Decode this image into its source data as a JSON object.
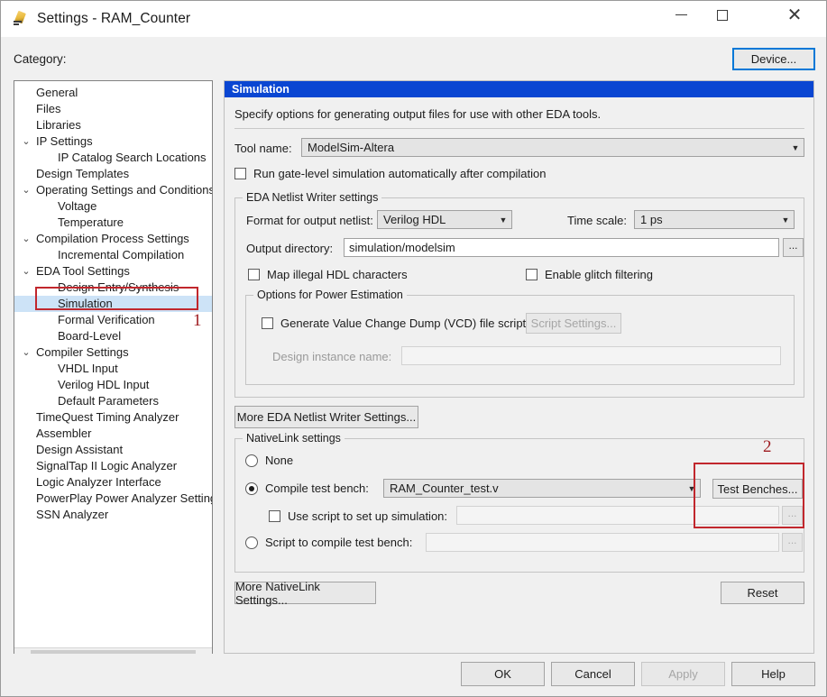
{
  "window": {
    "title": "Settings - RAM_Counter",
    "icon": "quartus-settings-icon",
    "minimize": "—",
    "maximize": "❑",
    "close": "✕"
  },
  "category": {
    "label": "Category:",
    "device_button": "Device...",
    "items": [
      {
        "label": "General",
        "level": 0,
        "chevron": "",
        "selected": false
      },
      {
        "label": "Files",
        "level": 0,
        "chevron": "",
        "selected": false
      },
      {
        "label": "Libraries",
        "level": 0,
        "chevron": "",
        "selected": false
      },
      {
        "label": "IP Settings",
        "level": 0,
        "chevron": "⌄",
        "selected": false
      },
      {
        "label": "IP Catalog Search Locations",
        "level": 1,
        "chevron": "",
        "selected": false
      },
      {
        "label": "Design Templates",
        "level": 0,
        "chevron": "",
        "selected": false
      },
      {
        "label": "Operating Settings and Conditions",
        "level": 0,
        "chevron": "⌄",
        "selected": false
      },
      {
        "label": "Voltage",
        "level": 1,
        "chevron": "",
        "selected": false
      },
      {
        "label": "Temperature",
        "level": 1,
        "chevron": "",
        "selected": false
      },
      {
        "label": "Compilation Process Settings",
        "level": 0,
        "chevron": "⌄",
        "selected": false
      },
      {
        "label": "Incremental Compilation",
        "level": 1,
        "chevron": "",
        "selected": false
      },
      {
        "label": "EDA Tool Settings",
        "level": 0,
        "chevron": "⌄",
        "selected": false
      },
      {
        "label": "Design Entry/Synthesis",
        "level": 1,
        "chevron": "",
        "selected": false
      },
      {
        "label": "Simulation",
        "level": 1,
        "chevron": "",
        "selected": true
      },
      {
        "label": "Formal Verification",
        "level": 1,
        "chevron": "",
        "selected": false
      },
      {
        "label": "Board-Level",
        "level": 1,
        "chevron": "",
        "selected": false
      },
      {
        "label": "Compiler Settings",
        "level": 0,
        "chevron": "⌄",
        "selected": false
      },
      {
        "label": "VHDL Input",
        "level": 1,
        "chevron": "",
        "selected": false
      },
      {
        "label": "Verilog HDL Input",
        "level": 1,
        "chevron": "",
        "selected": false
      },
      {
        "label": "Default Parameters",
        "level": 1,
        "chevron": "",
        "selected": false
      },
      {
        "label": "TimeQuest Timing Analyzer",
        "level": 0,
        "chevron": "",
        "selected": false
      },
      {
        "label": "Assembler",
        "level": 0,
        "chevron": "",
        "selected": false
      },
      {
        "label": "Design Assistant",
        "level": 0,
        "chevron": "",
        "selected": false
      },
      {
        "label": "SignalTap II Logic Analyzer",
        "level": 0,
        "chevron": "",
        "selected": false
      },
      {
        "label": "Logic Analyzer Interface",
        "level": 0,
        "chevron": "",
        "selected": false
      },
      {
        "label": "PowerPlay Power Analyzer Settings",
        "level": 0,
        "chevron": "",
        "selected": false
      },
      {
        "label": "SSN Analyzer",
        "level": 0,
        "chevron": "",
        "selected": false
      }
    ],
    "scroll_left": "‹",
    "scroll_right": "›"
  },
  "panel": {
    "header": "Simulation",
    "description": "Specify options for generating output files for use with other EDA tools.",
    "tool_name_label": "Tool name:",
    "tool_name_value": "ModelSim-Altera",
    "run_gatelevel_label": "Run gate-level simulation automatically after compilation",
    "run_gatelevel_checked": false
  },
  "netlist_writer": {
    "group_title": "EDA Netlist Writer settings",
    "format_label": "Format for output netlist:",
    "format_value": "Verilog HDL",
    "timescale_label": "Time scale:",
    "timescale_value": "1 ps",
    "output_dir_label": "Output directory:",
    "output_dir_value": "simulation/modelsim",
    "browse_button": "...",
    "map_illegal_label": "Map illegal HDL characters",
    "map_illegal_checked": false,
    "glitch_label": "Enable glitch filtering",
    "glitch_checked": false
  },
  "power_estimation": {
    "group_title": "Options for Power Estimation",
    "vcd_label": "Generate Value Change Dump (VCD) file script",
    "vcd_checked": false,
    "script_settings_button": "Script Settings...",
    "instance_label": "Design instance name:",
    "instance_value": ""
  },
  "more_eda_button": "More EDA Netlist Writer Settings...",
  "nativelink": {
    "group_title": "NativeLink settings",
    "none_label": "None",
    "none_selected": false,
    "compile_tb_label": "Compile test bench:",
    "compile_tb_selected": true,
    "compile_tb_value": "RAM_Counter_test.v",
    "test_benches_button": "Test Benches...",
    "use_script_label": "Use script to set up simulation:",
    "use_script_checked": false,
    "use_script_value": "",
    "use_script_browse": "...",
    "script_compile_label": "Script to compile test bench:",
    "script_compile_selected": false,
    "script_compile_value": "",
    "script_compile_browse": "..."
  },
  "more_nativelink_button": "More NativeLink Settings...",
  "reset_button": "Reset",
  "footer": {
    "ok": "OK",
    "cancel": "Cancel",
    "apply": "Apply",
    "help": "Help"
  },
  "annotations": [
    {
      "number": "1"
    },
    {
      "number": "2"
    }
  ],
  "colors": {
    "panel_header": "#0a46d2",
    "selection": "#cde3f7",
    "accent_border": "#0078d7",
    "annotation": "#c1272d"
  }
}
